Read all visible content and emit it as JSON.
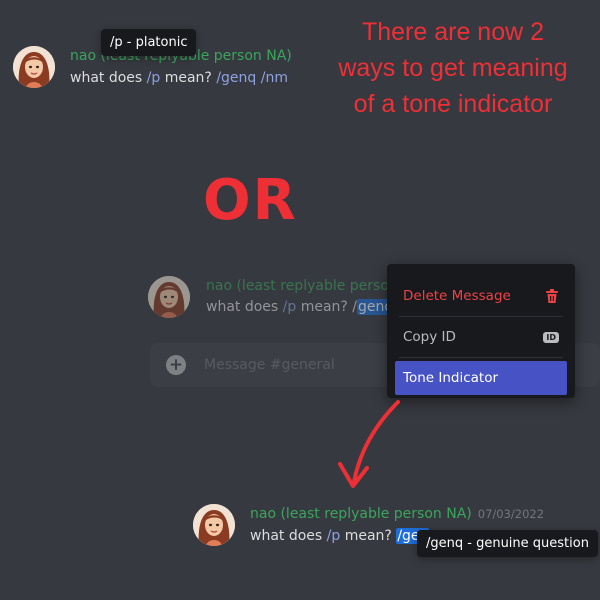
{
  "top": {
    "username": "nao (least replyable person NA)",
    "message_prefix": "what does ",
    "ti_p": "/p",
    "message_mid": " mean? ",
    "ti_genq": "/genq",
    "ti_nm": "/nm",
    "tooltip": "/p - platonic"
  },
  "annotation": {
    "lines": [
      "There are now 2",
      "ways to get meaning",
      "of a tone indicator"
    ],
    "or": "OR"
  },
  "middle": {
    "username": "nao (least replyable person",
    "message_prefix": "what does ",
    "ti_p": "/p",
    "message_mid": " mean? /",
    "highlighted": "genq",
    "input_placeholder": "Message #general"
  },
  "context_menu": {
    "items": [
      {
        "label": "Delete Message",
        "icon": "trash-icon"
      },
      {
        "label": "Copy ID",
        "icon": "id-badge-icon",
        "badge": "ID"
      },
      {
        "label": "Tone Indicator",
        "icon": ""
      }
    ]
  },
  "bottom": {
    "username": "nao (least replyable person NA)",
    "timestamp": "07/03/2022",
    "message_prefix": "what does ",
    "ti_p": "/p",
    "message_mid": " mean? ",
    "highlighted": "/gen",
    "tooltip": "/genq - genuine question"
  },
  "colors": {
    "background": "#36393f",
    "username": "#3ba55c",
    "tone_indicator": "#8ea1e1",
    "annotation_red": "#ef2f36",
    "menu_active": "#4752c4",
    "danger": "#ed4245"
  }
}
